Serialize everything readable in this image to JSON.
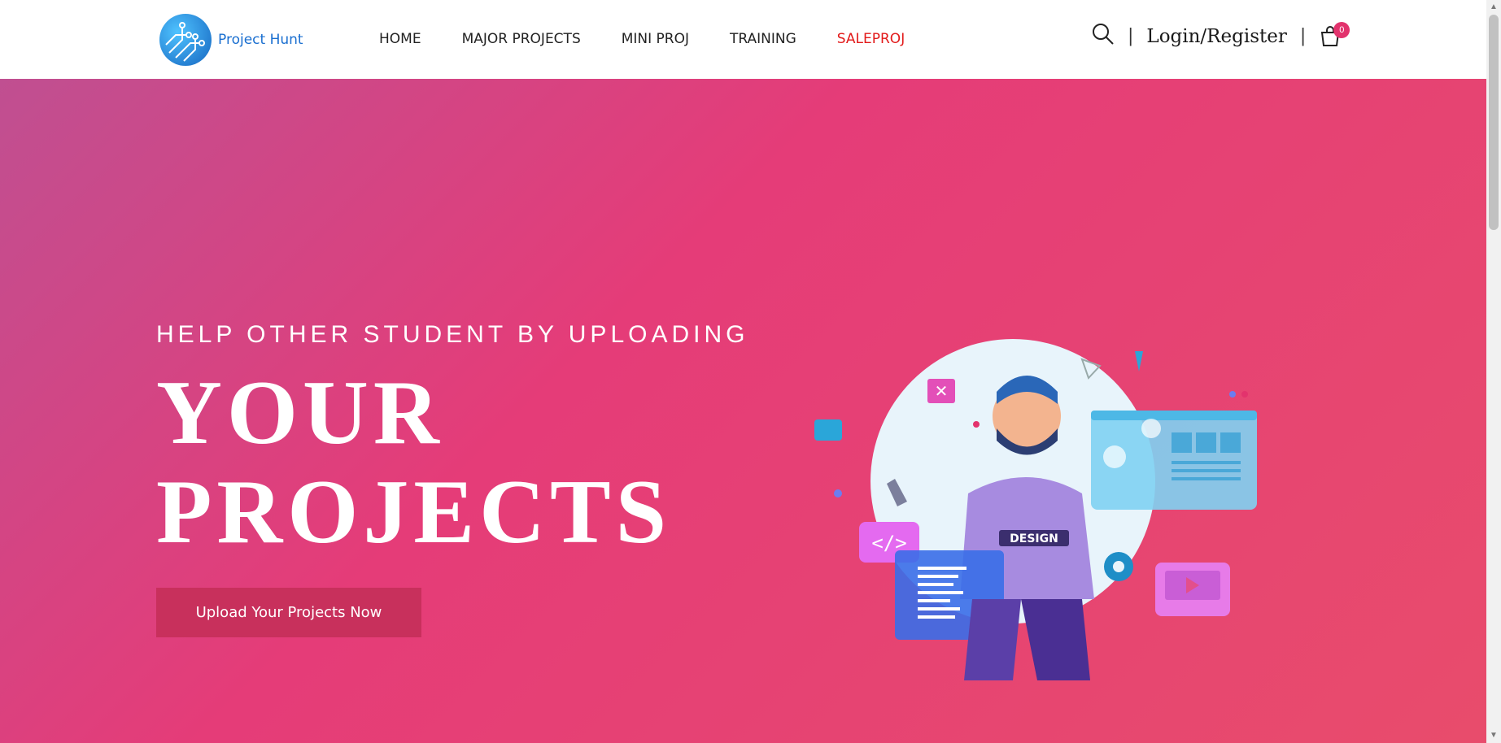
{
  "brand": {
    "name": "Project Hunt"
  },
  "nav": {
    "items": [
      "HOME",
      "MAJOR PROJECTS",
      "MINI PROJ",
      "TRAINING",
      "SALEPROJ"
    ]
  },
  "header": {
    "search_icon": "search-icon",
    "login_label": "Login/Register",
    "cart_count": "0"
  },
  "hero": {
    "kicker": "HELP OTHER STUDENT BY UPLOADING",
    "headline_line1": "YOUR",
    "headline_line2": "PROJECTS",
    "cta_label": "Upload Your Projects Now",
    "badge_text": "DESIGN"
  },
  "colors": {
    "accent": "#e53c78",
    "sale": "#e21a1a",
    "cta": "#c8305c"
  }
}
